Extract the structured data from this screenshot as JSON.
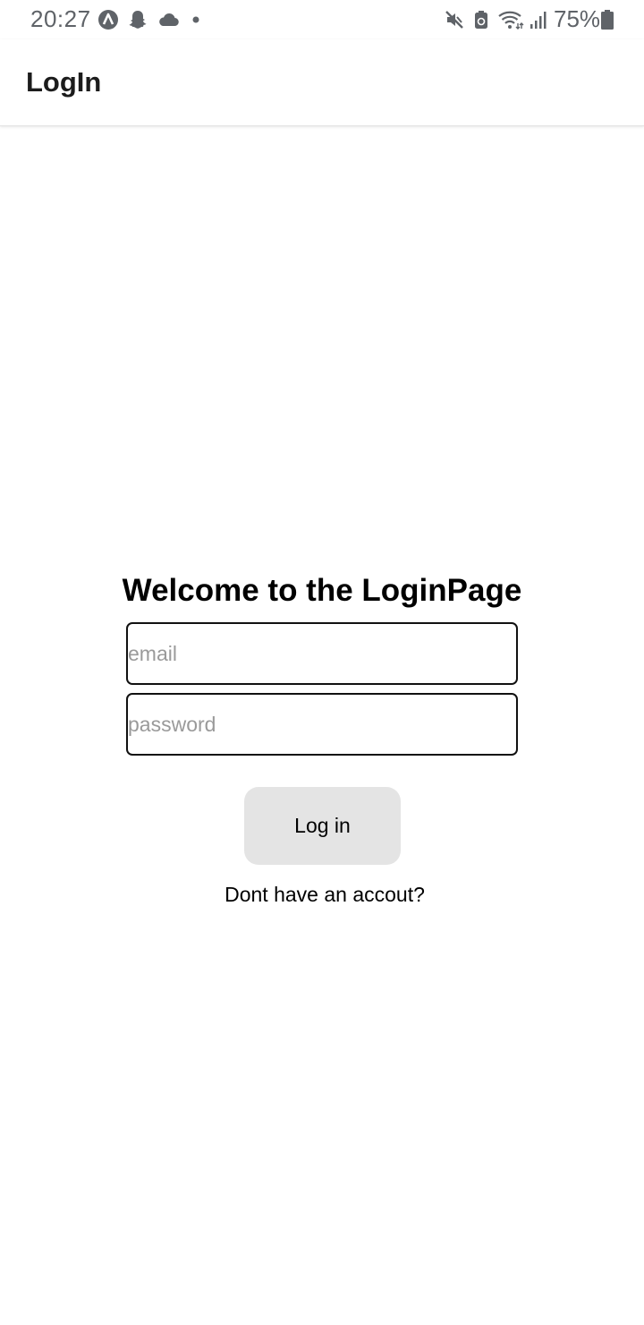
{
  "status_bar": {
    "time": "20:27",
    "battery_percent": "75%",
    "left_icons": [
      "app-notification-icon",
      "snapchat-ghost-icon",
      "cloud-icon",
      "dot-icon"
    ],
    "right_icons": [
      "mute-icon",
      "battery-saver-icon",
      "wifi-icon",
      "signal-icon",
      "battery-icon"
    ]
  },
  "app_bar": {
    "title": "LogIn"
  },
  "login": {
    "heading": "Welcome to the LoginPage",
    "email_placeholder": "email",
    "email_value": "",
    "password_placeholder": "password",
    "password_value": "",
    "login_button_label": "Log in",
    "signup_link": "Dont have an accout?"
  }
}
